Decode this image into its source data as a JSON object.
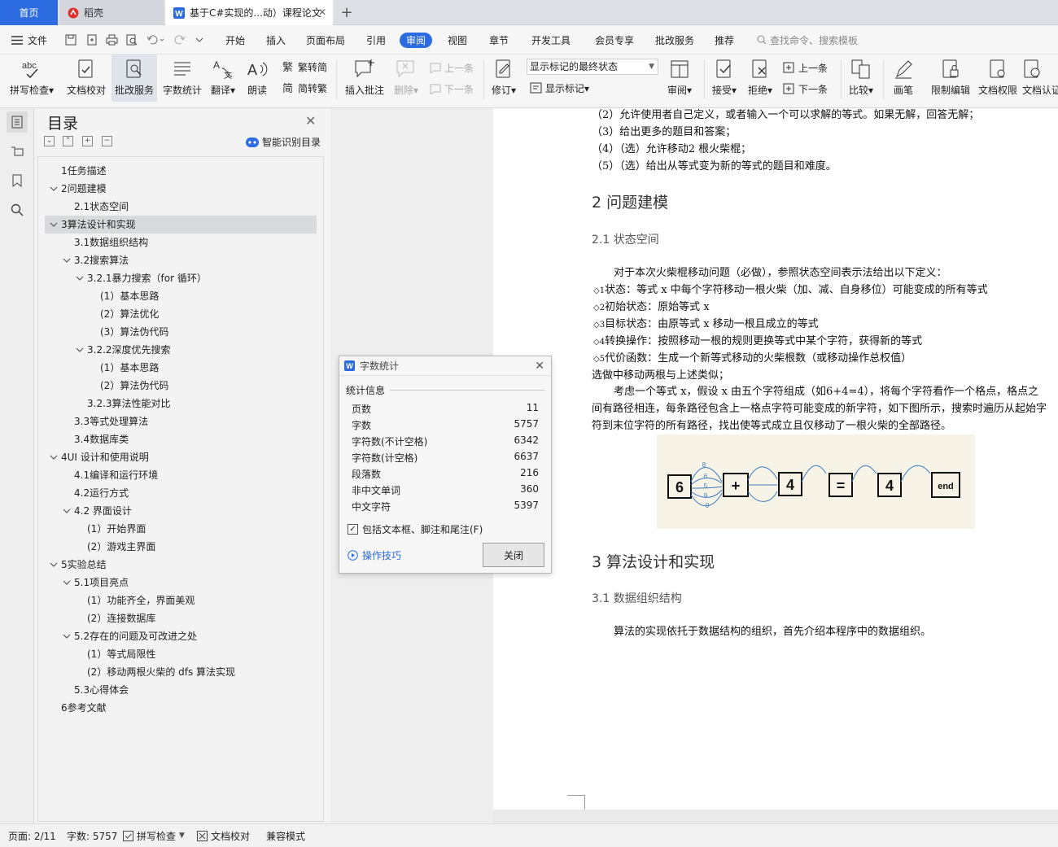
{
  "tabs": {
    "home": "首页",
    "daoke": "稻壳",
    "document": "基于C#实现的...动）课程论文"
  },
  "menu": {
    "file": "文件",
    "items": [
      "开始",
      "插入",
      "页面布局",
      "引用",
      "审阅",
      "视图",
      "章节",
      "开发工具",
      "会员专享",
      "批改服务",
      "推荐"
    ],
    "active": "审阅",
    "search_placeholder": "查找命令、搜索模板"
  },
  "ribbon": {
    "spell_check": "拼写检查",
    "doc_check": "文档校对",
    "review_service": "批改服务",
    "word_count": "字数统计",
    "translate": "翻译",
    "read_aloud": "朗读",
    "to_traditional": "繁转简",
    "to_simplified": "简转繁",
    "insert_comment": "插入批注",
    "delete": "删除",
    "prev": "上一条",
    "next": "下一条",
    "track_changes": "修订",
    "markup_mode": "显示标记的最终状态",
    "show_markup": "显示标记",
    "review": "审阅",
    "accept": "接受",
    "reject": "拒绝",
    "prev2": "上一条",
    "next2": "下一条",
    "compare": "比较",
    "pen": "画笔",
    "restrict_edit": "限制编辑",
    "doc_permission": "文档权限",
    "doc_cert": "文档认证"
  },
  "nav": {
    "title": "目录",
    "smart_toc": "智能识别目录",
    "items": [
      {
        "text": "1任务描述",
        "level": 1,
        "chevron": false,
        "selected": false
      },
      {
        "text": "2问题建模",
        "level": 1,
        "chevron": true,
        "selected": false
      },
      {
        "text": "2.1状态空间",
        "level": 2,
        "chevron": false,
        "selected": false
      },
      {
        "text": "3算法设计和实现",
        "level": 1,
        "chevron": true,
        "selected": true
      },
      {
        "text": "3.1数据组织结构",
        "level": 2,
        "chevron": false,
        "selected": false
      },
      {
        "text": "3.2搜索算法",
        "level": 2,
        "chevron": true,
        "selected": false
      },
      {
        "text": "3.2.1暴力搜索（for 循环）",
        "level": 3,
        "chevron": true,
        "selected": false
      },
      {
        "text": "(1）基本思路",
        "level": 4,
        "chevron": false,
        "selected": false
      },
      {
        "text": "(2）算法优化",
        "level": 4,
        "chevron": false,
        "selected": false
      },
      {
        "text": "(3）算法伪代码",
        "level": 4,
        "chevron": false,
        "selected": false
      },
      {
        "text": "3.2.2深度优先搜索",
        "level": 3,
        "chevron": true,
        "selected": false
      },
      {
        "text": "(1）基本思路",
        "level": 4,
        "chevron": false,
        "selected": false
      },
      {
        "text": "(2）算法伪代码",
        "level": 4,
        "chevron": false,
        "selected": false
      },
      {
        "text": "3.2.3算法性能对比",
        "level": 3,
        "chevron": false,
        "selected": false
      },
      {
        "text": "3.3等式处理算法",
        "level": 2,
        "chevron": false,
        "selected": false
      },
      {
        "text": "3.4数据库类",
        "level": 2,
        "chevron": false,
        "selected": false
      },
      {
        "text": "4UI 设计和使用说明",
        "level": 1,
        "chevron": true,
        "selected": false
      },
      {
        "text": "4.1编译和运行环境",
        "level": 2,
        "chevron": false,
        "selected": false
      },
      {
        "text": "4.2运行方式",
        "level": 2,
        "chevron": false,
        "selected": false
      },
      {
        "text": "4.2 界面设计",
        "level": 2,
        "chevron": true,
        "selected": false
      },
      {
        "text": "(1）开始界面",
        "level": 3,
        "chevron": false,
        "selected": false
      },
      {
        "text": "(2）游戏主界面",
        "level": 3,
        "chevron": false,
        "selected": false
      },
      {
        "text": "5实验总结",
        "level": 1,
        "chevron": true,
        "selected": false
      },
      {
        "text": "5.1项目亮点",
        "level": 2,
        "chevron": true,
        "selected": false
      },
      {
        "text": "(1）功能齐全，界面美观",
        "level": 3,
        "chevron": false,
        "selected": false
      },
      {
        "text": "(2）连接数据库",
        "level": 3,
        "chevron": false,
        "selected": false
      },
      {
        "text": "5.2存在的问题及可改进之处",
        "level": 2,
        "chevron": true,
        "selected": false
      },
      {
        "text": "(1）等式局限性",
        "level": 3,
        "chevron": false,
        "selected": false
      },
      {
        "text": "(2）移动两根火柴的 dfs 算法实现",
        "level": 3,
        "chevron": false,
        "selected": false
      },
      {
        "text": "5.3心得体会",
        "level": 2,
        "chevron": false,
        "selected": false
      },
      {
        "text": "6参考文献",
        "level": 1,
        "chevron": false,
        "selected": false
      }
    ]
  },
  "doc": {
    "list_items": [
      "（2）允许使用者自己定义，或者输入一个可以求解的等式。如果无解，回答无解；",
      "（3）给出更多的题目和答案；",
      "（4）（选）允许移动2 根火柴棍；",
      "（5）（选）给出从等式变为新的等式的题目和难度。"
    ],
    "h_2": "2 问题建模",
    "h_2_1": "2.1 状态空间",
    "p_intro": "对于本次火柴棍移动问题（必做），参照状态空间表示法给出以下定义：",
    "defs": [
      {
        "marker": "◇1",
        "text": "状态：等式 x 中每个字符移动一根火柴（加、减、自身移位）可能变成的所有等式"
      },
      {
        "marker": "◇2",
        "text": "初始状态：原始等式 x"
      },
      {
        "marker": "◇3",
        "text": "目标状态：由原等式 x 移动一根且成立的等式"
      },
      {
        "marker": "◇4",
        "text": "转换操作：按照移动一根的规则更换等式中某个字符，获得新的等式"
      },
      {
        "marker": "◇5",
        "text": "代价函数：生成一个新等式移动的火柴根数（或移动操作总权值）"
      }
    ],
    "p_similar": "选做中移动两根与上述类似；",
    "p_consider": "考虑一个等式 x，假设 x 由五个字符组成（如6+4=4），将每个字符看作一个格点，格点之间有路径相连，每条路径包含上一格点字符可能变成的新字符，如下图所示，搜索时遍历从起始字符到末位字符的所有路径，找出使等式成立且仅移动了一根火柴的全部路径。",
    "figure_cells": [
      "6",
      "+",
      "4",
      "=",
      "4",
      "end"
    ],
    "figure_branch": [
      "8",
      "6",
      "5",
      "9",
      "0"
    ],
    "h_3": "3 算法设计和实现",
    "h_3_1": "3.1 数据组织结构",
    "p_data": "算法的实现依托于数据结构的组织，首先介绍本程序中的数据组织。"
  },
  "dialog": {
    "title": "字数统计",
    "section": "统计信息",
    "rows": [
      {
        "label": "页数",
        "value": "11"
      },
      {
        "label": "字数",
        "value": "5757"
      },
      {
        "label": "字符数(不计空格)",
        "value": "6342"
      },
      {
        "label": "字符数(计空格)",
        "value": "6637"
      },
      {
        "label": "段落数",
        "value": "216"
      },
      {
        "label": "非中文单词",
        "value": "360"
      },
      {
        "label": "中文字符",
        "value": "5397"
      }
    ],
    "include_label": "包括文本框、脚注和尾注(F)",
    "include_checked": true,
    "tips": "操作技巧",
    "close": "关闭"
  },
  "status": {
    "page": "页面: 2/11",
    "words": "字数: 5757",
    "spell": "拼写检查",
    "doc_check": "文档校对",
    "compat": "兼容模式"
  },
  "colors": {
    "accent": "#2c6be0",
    "brand_red": "#e0302e"
  }
}
